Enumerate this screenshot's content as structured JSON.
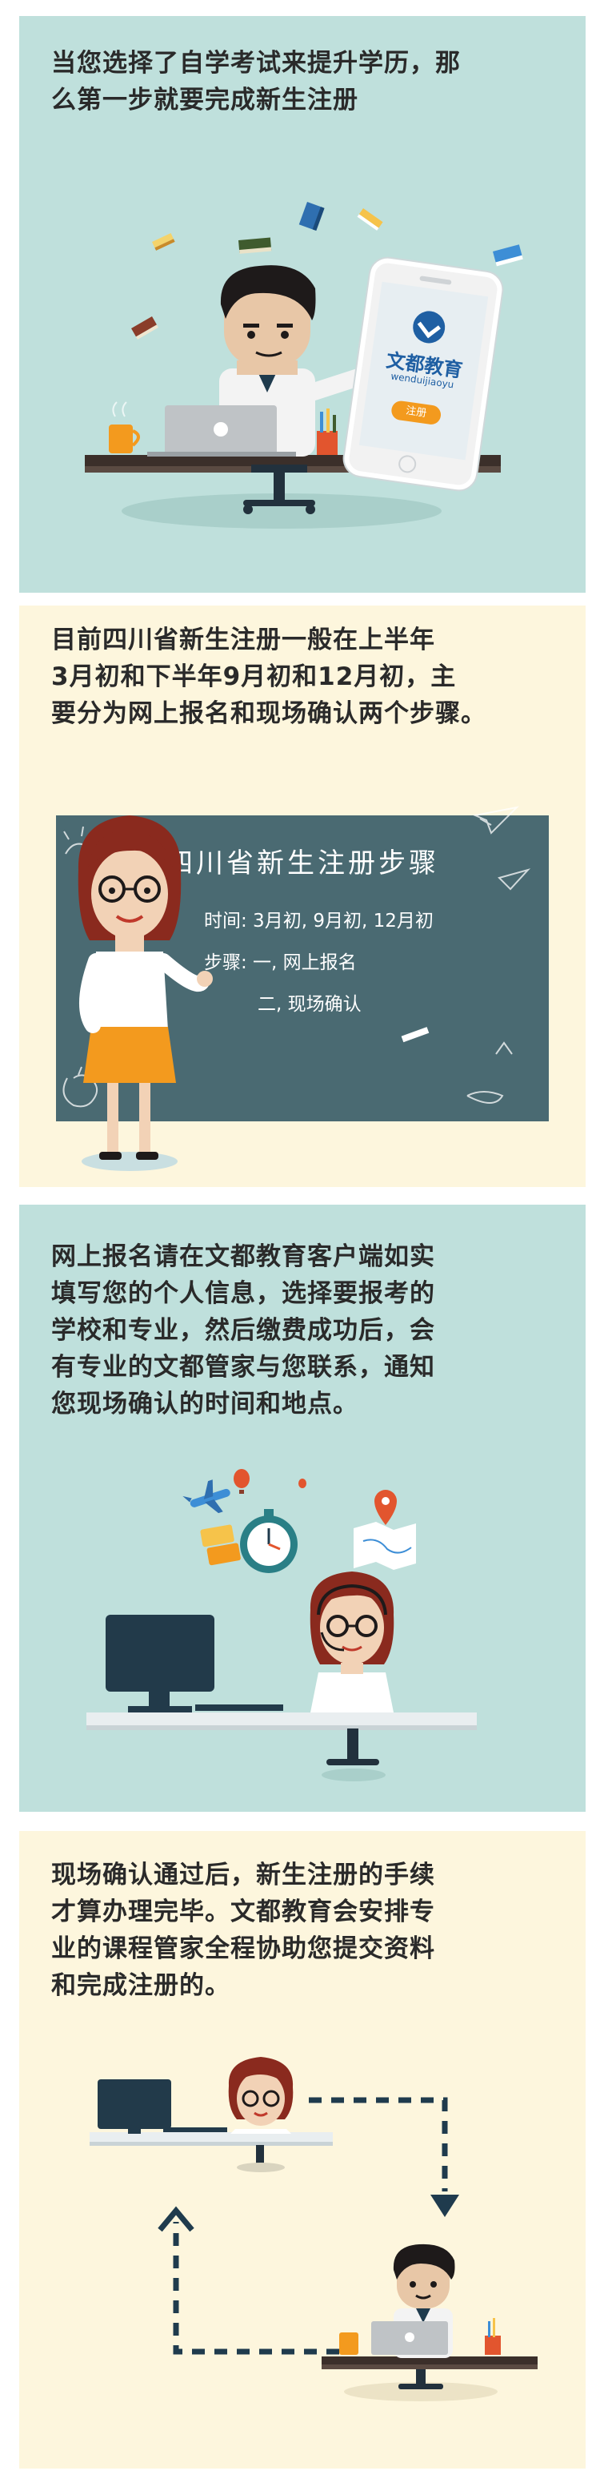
{
  "colors": {
    "teal_panel": "#bfe0dc",
    "cream_panel": "#fdf6dd",
    "chalkboard": "#4a6a72",
    "accent_orange": "#f39a1e",
    "phone_blue": "#1f5fa3",
    "navy": "#1f3b4d"
  },
  "section1": {
    "lines": [
      "当您选择了自学考试来提升学历，那",
      "么第一步就要完成新生注册"
    ],
    "phone": {
      "brand_cn": "文都教育",
      "brand_pinyin": "wenduijiaoyu",
      "button": "注册"
    }
  },
  "section2": {
    "lines": [
      "目前四川省新生注册一般在上半年",
      "3月初和下半年9月初和12月初，主",
      "要分为网上报名和现场确认两个步骤。"
    ],
    "board": {
      "title": "四川省新生注册步骤",
      "time_line": "时间: 3月初, 9月初, 12月初",
      "step1_line": "步骤: 一, 网上报名",
      "step2_line": "二, 现场确认"
    }
  },
  "section3": {
    "lines": [
      "网上报名请在文都教育客户端如实",
      "填写您的个人信息，选择要报考的",
      "学校和专业，然后缴费成功后，会",
      "有专业的文都管家与您联系，通知",
      "您现场确认的时间和地点。"
    ]
  },
  "section4": {
    "lines": [
      "现场确认通过后，新生注册的手续",
      "才算办理完毕。文都教育会安排专",
      "业的课程管家全程协助您提交资料",
      "和完成注册的。"
    ]
  }
}
